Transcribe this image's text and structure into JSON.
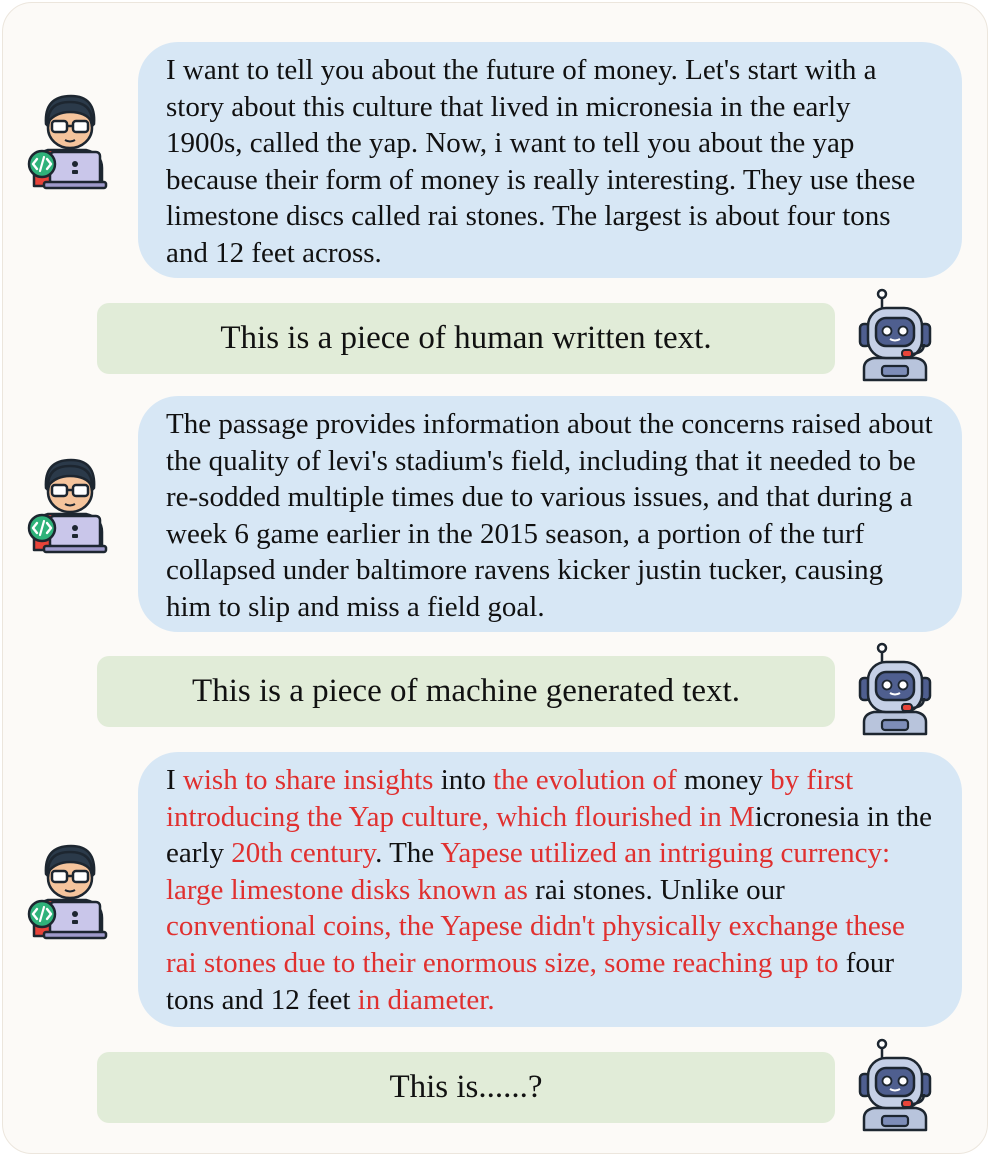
{
  "conversation": [
    {
      "role": "user",
      "avatar_icon": "programmer-avatar-icon",
      "segments": [
        {
          "text": "I want to tell you about the future of money. Let's start with a story about this culture that lived in micronesia in the early 1900s, called the yap. Now, i want to tell you about the yap because their form of money is really interesting. They use these limestone discs called rai stones. The largest is about four tons and 12 feet across.",
          "highlight": false
        }
      ]
    },
    {
      "role": "bot",
      "avatar_icon": "robot-avatar-icon",
      "text": "This is a piece of human written text."
    },
    {
      "role": "user",
      "avatar_icon": "programmer-avatar-icon",
      "segments": [
        {
          "text": "The passage provides information about the concerns raised about the quality of levi's stadium's field, including that it needed to be re-sodded multiple times due to various issues, and that during a week 6 game earlier in the 2015 season, a portion of the turf collapsed under baltimore ravens kicker justin tucker, causing him to slip and miss a field goal.",
          "highlight": false
        }
      ]
    },
    {
      "role": "bot",
      "avatar_icon": "robot-avatar-icon",
      "text": "This is a piece of machine generated text."
    },
    {
      "role": "user",
      "avatar_icon": "programmer-avatar-icon",
      "segments": [
        {
          "text": "I ",
          "highlight": false
        },
        {
          "text": "wish to share insights",
          "highlight": true
        },
        {
          "text": " into ",
          "highlight": false
        },
        {
          "text": "the evolution of",
          "highlight": true
        },
        {
          "text": " money ",
          "highlight": false
        },
        {
          "text": "by first introducing the Yap culture, which flourished in M",
          "highlight": true
        },
        {
          "text": "icronesia in the early ",
          "highlight": false
        },
        {
          "text": "20th century",
          "highlight": true
        },
        {
          "text": ". The ",
          "highlight": false
        },
        {
          "text": "Yapese utilized an intriguing currency: large limestone disks known as",
          "highlight": true
        },
        {
          "text": " rai stones. Unlike our ",
          "highlight": false
        },
        {
          "text": "conventional coins, the Yapese didn't physically exchange these rai stones due to their enormous size, some reaching up to",
          "highlight": true
        },
        {
          "text": " four tons and 12 feet ",
          "highlight": false
        },
        {
          "text": "in diameter.",
          "highlight": true
        }
      ]
    },
    {
      "role": "bot",
      "avatar_icon": "robot-avatar-icon",
      "text": "This is......?"
    }
  ],
  "colors": {
    "user_bubble": "#d7e7f5",
    "bot_bubble": "#e1ecd8",
    "highlight_text": "#e0302f",
    "frame_background": "#fcfaf7"
  }
}
